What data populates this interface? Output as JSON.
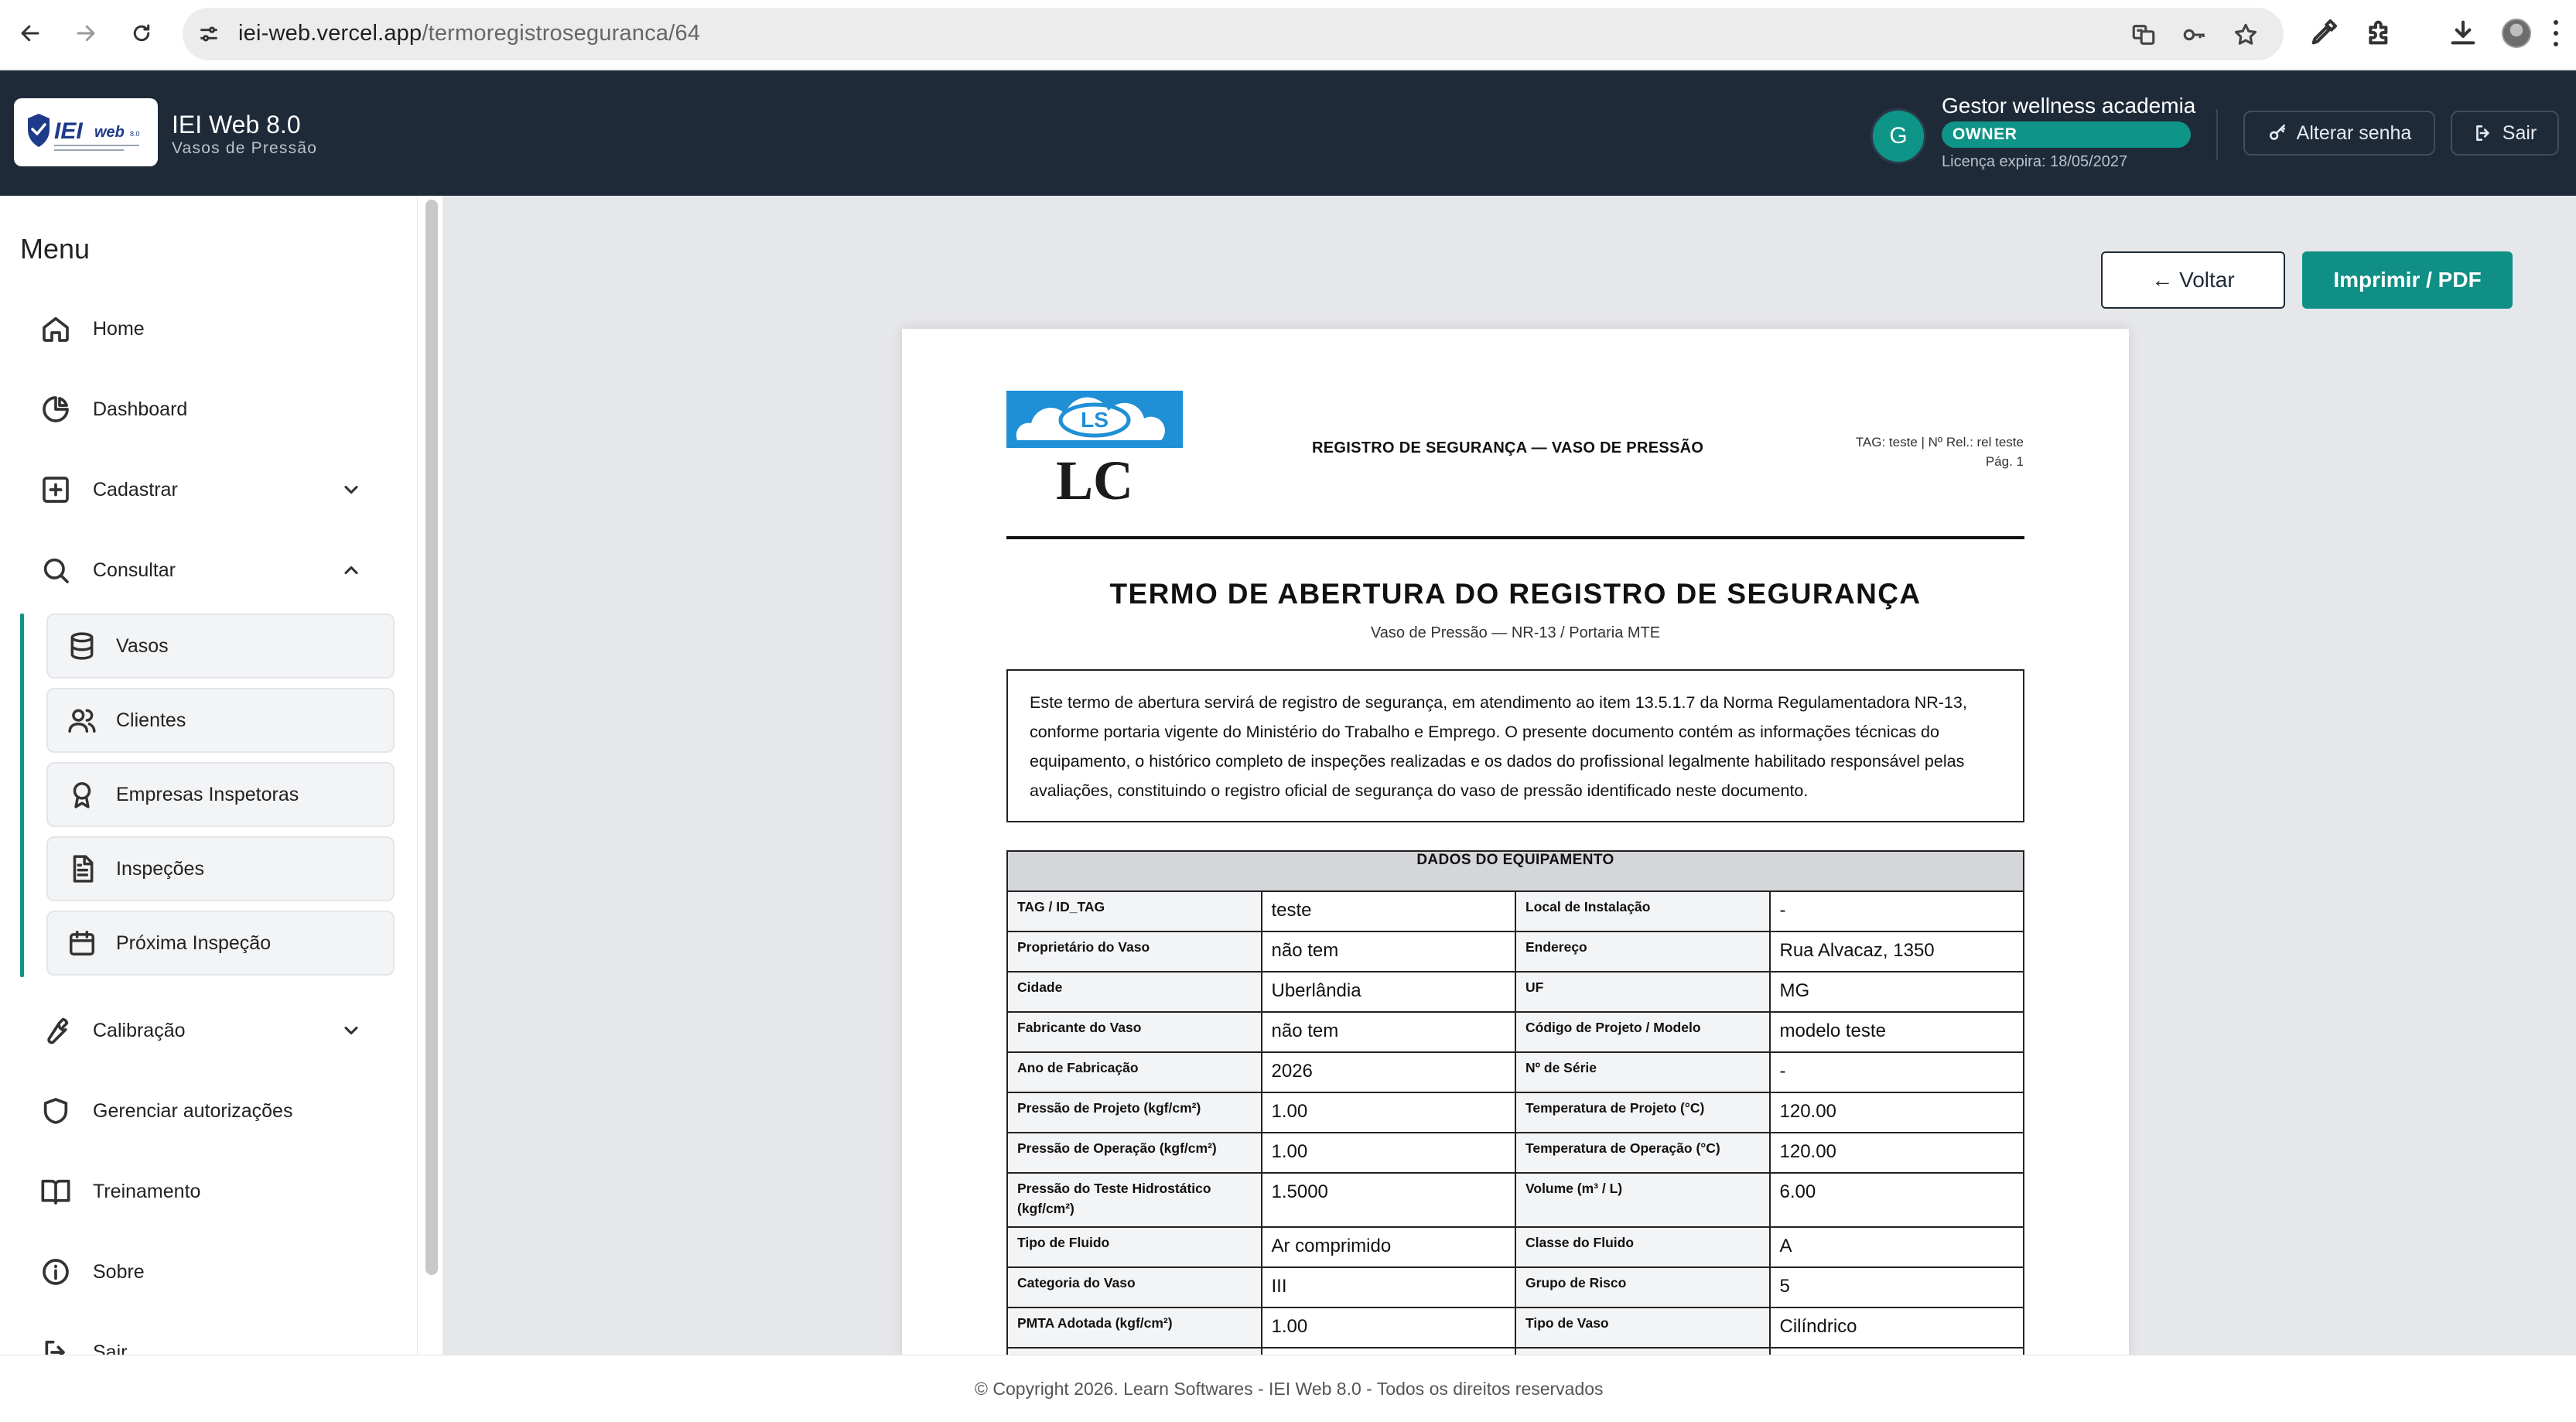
{
  "browser": {
    "url_host": "iei-web.vercel.app",
    "url_path": "/termoregistroseguranca/64"
  },
  "header": {
    "app_title": "IEI Web 8.0",
    "app_subtitle": "Vasos de Pressão",
    "avatar_letter": "G",
    "user_name": "Gestor wellness academia",
    "role_badge": "OWNER",
    "license": "Licença expira: 18/05/2027",
    "change_password": "Alterar senha",
    "logout": "Sair"
  },
  "sidebar": {
    "title": "Menu",
    "items": {
      "home": "Home",
      "dashboard": "Dashboard",
      "cadastrar": "Cadastrar",
      "consultar": "Consultar",
      "calibracao": "Calibração",
      "autorizacoes": "Gerenciar autorizações",
      "treinamento": "Treinamento",
      "sobre": "Sobre",
      "sair": "Sair"
    },
    "consultar_sub": {
      "vasos": "Vasos",
      "clientes": "Clientes",
      "empresas": "Empresas Inspetoras",
      "inspecoes": "Inspeções",
      "proxima": "Próxima Inspeção"
    }
  },
  "actions": {
    "back": "← Voltar",
    "print": "Imprimir / PDF"
  },
  "document": {
    "header_title": "REGISTRO DE SEGURANÇA — VASO DE PRESSÃO",
    "tag_line": "TAG: teste | Nº Rel.: rel teste",
    "page_line": "Pág. 1",
    "main_title": "TERMO DE ABERTURA DO REGISTRO DE SEGURANÇA",
    "main_subtitle": "Vaso de Pressão — NR-13 / Portaria MTE",
    "paragraph": "Este termo de abertura servirá de registro de segurança, em atendimento ao item 13.5.1.7 da Norma Regulamentadora NR-13, conforme portaria vigente do Ministério do Trabalho e Emprego. O presente documento contém as informações técnicas do equipamento, o histórico completo de inspeções realizadas e os dados do profissional legalmente habilitado responsável pelas avaliações, constituindo o registro oficial de segurança do vaso de pressão identificado neste documento.",
    "table_title": "DADOS DO EQUIPAMENTO",
    "rows": [
      {
        "l1": "TAG / ID_TAG",
        "v1": "teste",
        "l2": "Local de Instalação",
        "v2": "-"
      },
      {
        "l1": "Proprietário do Vaso",
        "v1": "não tem",
        "l2": "Endereço",
        "v2": "Rua Alvacaz, 1350"
      },
      {
        "l1": "Cidade",
        "v1": "Uberlândia",
        "l2": "UF",
        "v2": "MG"
      },
      {
        "l1": "Fabricante do Vaso",
        "v1": "não tem",
        "l2": "Código de Projeto / Modelo",
        "v2": "modelo teste"
      },
      {
        "l1": "Ano de Fabricação",
        "v1": "2026",
        "l2": "Nº de Série",
        "v2": "-"
      },
      {
        "l1": "Pressão de Projeto (kgf/cm²)",
        "v1": "1.00",
        "l2": "Temperatura de Projeto (°C)",
        "v2": "120.00"
      },
      {
        "l1": "Pressão de Operação (kgf/cm²)",
        "v1": "1.00",
        "l2": "Temperatura de Operação (°C)",
        "v2": "120.00"
      },
      {
        "l1": "Pressão do Teste Hidrostático (kgf/cm²)",
        "v1": "1.5000",
        "l2": "Volume (m³ / L)",
        "v2": "6.00"
      },
      {
        "l1": "Tipo de Fluido",
        "v1": "Ar comprimido",
        "l2": "Classe do Fluido",
        "v2": "A"
      },
      {
        "l1": "Categoria do Vaso",
        "v1": "III",
        "l2": "Grupo de Risco",
        "v2": "5"
      },
      {
        "l1": "PMTA Adotada (kgf/cm²)",
        "v1": "1.00",
        "l2": "Tipo de Vaso",
        "v2": "Cilíndrico"
      }
    ]
  },
  "footer": {
    "copyright": "© Copyright 2026. Learn Softwares - IEI Web 8.0 - Todos os direitos reservados"
  },
  "colors": {
    "header_bg": "#1e2a38",
    "accent_teal": "#0f9488",
    "content_bg": "#e6e7ea"
  }
}
